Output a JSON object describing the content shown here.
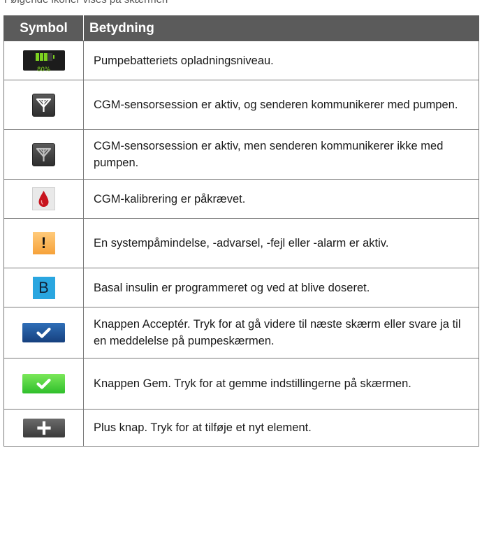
{
  "header_cut_text": "Følgende ikoner vises på skærmen",
  "table": {
    "col_symbol": "Symbol",
    "col_meaning": "Betydning",
    "rows": [
      {
        "icon": "battery-icon",
        "battery_percent": "80%",
        "battery_level": 0.8,
        "description": "Pumpebatteriets opladningsniveau."
      },
      {
        "icon": "cgm-antenna-active-icon",
        "description": "CGM-sensorsession er aktiv, og senderen kommunikerer med pumpen."
      },
      {
        "icon": "cgm-antenna-no-communication-icon",
        "description": "CGM-sensorsession er aktiv, men senderen kommunikerer ikke med pumpen."
      },
      {
        "icon": "blood-drop-icon",
        "description": "CGM-kalibrering er påkrævet."
      },
      {
        "icon": "exclamation-icon",
        "symbol": "!",
        "description": "En systempåmindelse, -advarsel, -fejl eller -alarm er aktiv."
      },
      {
        "icon": "basal-icon",
        "symbol": "B",
        "description": "Basal insulin er programmeret og ved at blive doseret."
      },
      {
        "icon": "accept-button-icon",
        "description": "Knappen Acceptér. Tryk for at gå videre til næste skærm eller svare ja til en meddelelse på pumpeskærmen."
      },
      {
        "icon": "save-button-icon",
        "description": "Knappen Gem. Tryk for at gemme indstillingerne på skærmen."
      },
      {
        "icon": "plus-button-icon",
        "description": "Plus knap. Tryk for at tilføje et nyt element."
      }
    ]
  },
  "colors": {
    "header_bg": "#5b5b5b",
    "battery_green": "#7ed321",
    "warning_orange": "#f6a23a",
    "basal_blue": "#2aa6e0",
    "accept_blue": "#16407e",
    "save_green": "#2fbf2b"
  }
}
